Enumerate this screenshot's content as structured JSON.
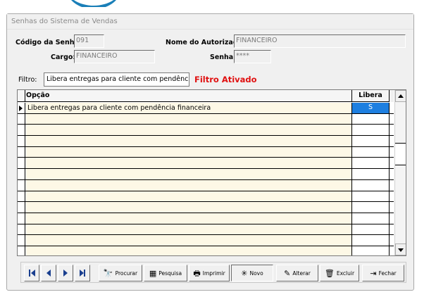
{
  "window": {
    "title": "Senhas do Sistema de Vendas"
  },
  "form": {
    "codigo_label": "Código da Senha:",
    "codigo_value": "091",
    "autorizado_label": "Nome do Autorizado:",
    "autorizado_value": "FINANCEIRO",
    "cargo_label": "Cargo:",
    "cargo_value": "FINANCEIRO",
    "senha_label": "Senha:",
    "senha_value": "****"
  },
  "filter": {
    "label": "Filtro:",
    "value": "Libera entregas para cliente com pendência f",
    "status": "Filtro Ativado",
    "status_color": "#e01010"
  },
  "grid": {
    "columns": [
      "Opção",
      "Libera"
    ],
    "rows": [
      {
        "opcao": "Libera entregas para cliente com pendência financeira",
        "libera": "S",
        "selected": true
      },
      {
        "opcao": "",
        "libera": ""
      },
      {
        "opcao": "",
        "libera": ""
      },
      {
        "opcao": "",
        "libera": ""
      },
      {
        "opcao": "",
        "libera": ""
      },
      {
        "opcao": "",
        "libera": ""
      },
      {
        "opcao": "",
        "libera": ""
      },
      {
        "opcao": "",
        "libera": ""
      },
      {
        "opcao": "",
        "libera": ""
      },
      {
        "opcao": "",
        "libera": ""
      },
      {
        "opcao": "",
        "libera": ""
      },
      {
        "opcao": "",
        "libera": ""
      },
      {
        "opcao": "",
        "libera": ""
      },
      {
        "opcao": "",
        "libera": ""
      }
    ],
    "selected_color": "#1e7fe0"
  },
  "toolbar": {
    "nav": [
      {
        "name": "first-record-button",
        "icon": "first-icon"
      },
      {
        "name": "previous-record-button",
        "icon": "previous-icon"
      },
      {
        "name": "next-record-button",
        "icon": "next-icon"
      },
      {
        "name": "last-record-button",
        "icon": "last-icon"
      }
    ],
    "buttons": [
      {
        "name": "procurar-button",
        "label": "Procurar",
        "icon": "binoculars-icon",
        "glyph": "🔭"
      },
      {
        "name": "pesquisa-button",
        "label": "Pesquisa",
        "icon": "grid-icon",
        "glyph": "▦"
      },
      {
        "name": "imprimir-button",
        "label": "Imprimir",
        "icon": "printer-icon",
        "glyph": "🖶"
      },
      {
        "name": "novo-button",
        "label": "Novo",
        "icon": "new-document-icon",
        "glyph": "✳"
      },
      {
        "name": "alterar-button",
        "label": "Alterar",
        "icon": "edit-wand-icon",
        "glyph": "✎"
      },
      {
        "name": "excluir-button",
        "label": "Excluir",
        "icon": "trash-icon",
        "glyph": "🗑"
      },
      {
        "name": "fechar-button",
        "label": "Fechar",
        "icon": "exit-door-icon",
        "glyph": "⇥"
      }
    ]
  }
}
